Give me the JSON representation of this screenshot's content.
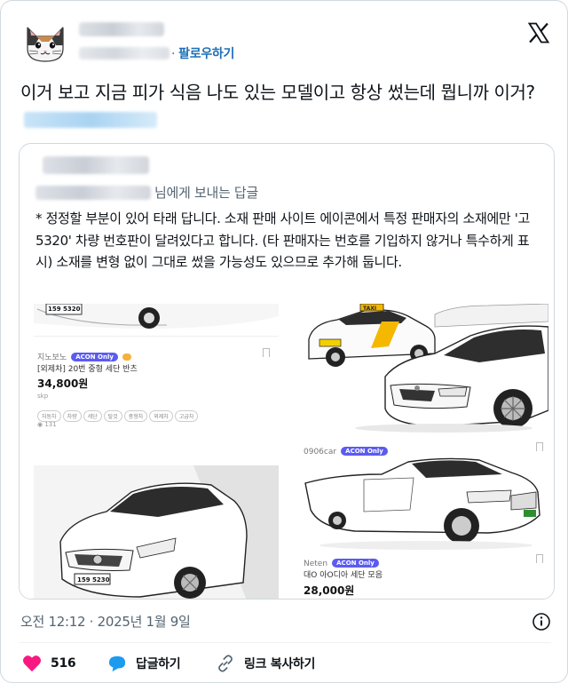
{
  "header": {
    "follow_label": "팔로우하기"
  },
  "tweet": {
    "text": "이거 보고 지금 피가 식음 나도 있는 모델이고 항상 썼는데 뭡니까 이거?"
  },
  "quote": {
    "reply_to_suffix": "님에게 보내는 답글",
    "body": "* 정정할 부분이 있어 타래 답니다. 소재 판매 사이트 에이콘에서 특정 판매자의 소재에만 '고 5320' 차량 번호판이 달려있다고 합니다. (타 판매자는 번호를 기입하지 않거나 특수하게 표시) 소재를 변형 없이 그대로 썼을 가능성도 있으므로 추가해 둡니다.",
    "screenshots": {
      "left_top": {
        "plate": "159 5320",
        "seller": "지노보노",
        "badge": "ACON Only",
        "product": "[외제차] 20번 중형 세단 반츠",
        "price": "34,800원",
        "format": "skp",
        "tags": [
          "자동차",
          "차량",
          "세단",
          "탈것",
          "중형차",
          "외제차",
          "고급차"
        ],
        "views": "131"
      },
      "left_bottom": {
        "plate": "159 5230"
      },
      "right_top": {
        "taxi_sign": "TAXI"
      },
      "right_bottom": {
        "seller_top": "0906car",
        "badge_top": "ACON Only",
        "seller": "Neten",
        "badge": "ACON Only",
        "product": "대O 아O디아 세단 모음",
        "price": "28,000원"
      }
    }
  },
  "footer": {
    "meta": "오전 12:12 · 2025년 1월 9일",
    "likes": "516",
    "reply_label": "답글하기",
    "copy_link_label": "링크 복사하기"
  },
  "colors": {
    "accent": "#1d9bf0",
    "follow": "#1d6fb8",
    "like": "#f91880",
    "secondary_text": "#536471",
    "border": "#cfd9de"
  },
  "icons": [
    "x-logo-icon",
    "cat-avatar-icon",
    "info-icon",
    "heart-icon",
    "reply-bubble-icon",
    "link-icon",
    "bookmark-icon"
  ]
}
